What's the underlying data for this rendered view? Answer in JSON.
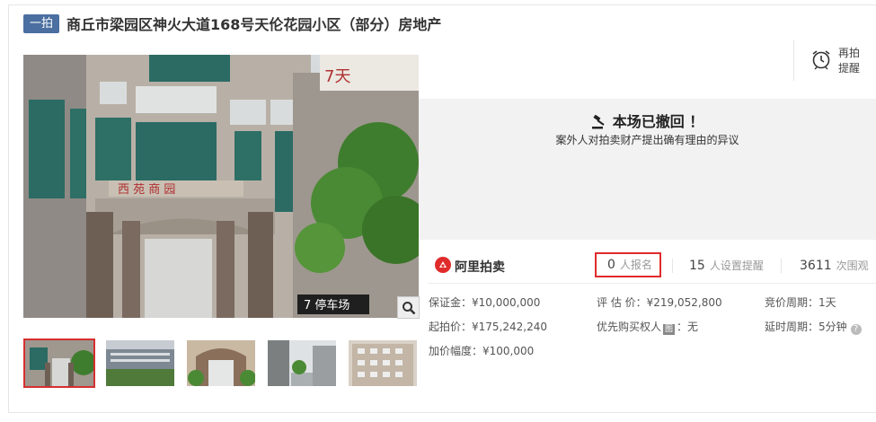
{
  "title": {
    "badge": "一拍",
    "text": "商丘市梁园区神火大道168号天伦花园小区（部分）房地产"
  },
  "remind": {
    "label": "再拍提醒",
    "icon": "alarm-clock-icon"
  },
  "status": {
    "heading": "本场已撤回 ！",
    "subtext": "案外人对拍卖财产提出确有理由的异议",
    "icon": "gavel-icon"
  },
  "brand": {
    "name": "阿里拍卖",
    "icon": "ali-auction-logo"
  },
  "stats": {
    "signups": {
      "count": "0",
      "unit": "人报名"
    },
    "reminders": {
      "count": "15",
      "unit": "人设置提醒"
    },
    "views": {
      "count": "3611",
      "unit": "次围观"
    }
  },
  "details": {
    "deposit": "保证金：¥10,000,000",
    "appraisal": "评 估 价：¥219,052,800",
    "bid_cycle": "竞价周期：1天",
    "start_price": "起拍价：¥175,242,240",
    "priority_label": "优先购买权人",
    "priority_tag": "图",
    "priority_value": "：无",
    "extension": "延时周期：5分钟",
    "increment": "加价幅度：¥100,000"
  },
  "colors": {
    "accent_red": "#e02b2b",
    "badge_blue": "#4a6fa0",
    "panel_gray": "#f2f2f2"
  }
}
